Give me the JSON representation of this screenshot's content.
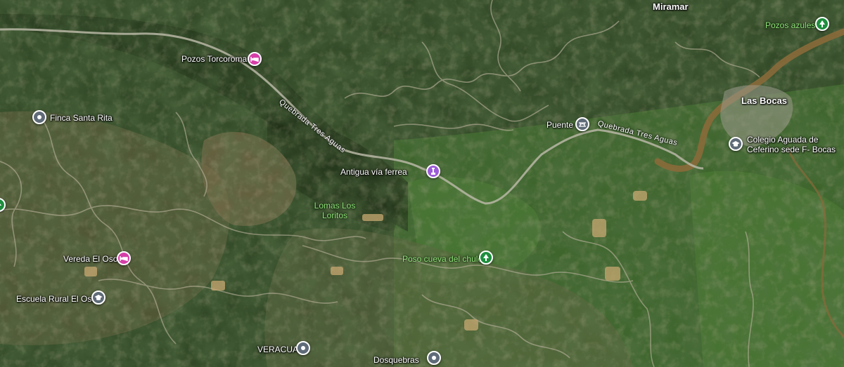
{
  "map": {
    "colors": {
      "poi_default": "#5f6b78",
      "poi_lodging": "#d63fa8",
      "poi_historic": "#9c5bd6",
      "poi_park": "#1e8e3e",
      "river": "#8a6a3a"
    },
    "towns": [
      {
        "id": "miramar",
        "name": "Miramar"
      },
      {
        "id": "las-bocas",
        "name": "Las Bocas"
      }
    ],
    "pois": [
      {
        "id": "pozos-torcoroma",
        "name": "Pozos Torcoroma",
        "icon": "bed-icon",
        "category": "lodging"
      },
      {
        "id": "finca-santa-rita",
        "name": "Finca Santa Rita",
        "icon": "generic-pin-icon",
        "category": "default"
      },
      {
        "id": "antigua-via-ferrea",
        "name": "Antigua vía ferrea",
        "icon": "monument-icon",
        "category": "historic"
      },
      {
        "id": "puente",
        "name": "Puente",
        "icon": "bridge-icon",
        "category": "default"
      },
      {
        "id": "colegio",
        "name": "Colegio Aguada de Ceferino sede F- Bocas",
        "icon": "school-icon",
        "category": "default"
      },
      {
        "id": "pozos-azules",
        "name": "Pozos azules",
        "icon": "tree-icon",
        "category": "park"
      },
      {
        "id": "vereda-el-oso",
        "name": "Vereda El Oso",
        "icon": "bed-icon",
        "category": "lodging"
      },
      {
        "id": "escuela-rural-el-oso",
        "name": "Escuela Rural El Oso",
        "icon": "school-icon",
        "category": "default"
      },
      {
        "id": "poso-cueva-del-chulo",
        "name": "Poso cueva del chulo",
        "icon": "tree-icon",
        "category": "park"
      },
      {
        "id": "veracua",
        "name": "VERACUA",
        "icon": "generic-pin-icon",
        "category": "default"
      },
      {
        "id": "dosquebras",
        "name": "Dosquebras",
        "icon": "generic-pin-icon",
        "category": "default"
      }
    ],
    "park_areas": [
      {
        "id": "lomas-los-loritos",
        "name": "Lomas Los Loritos"
      }
    ],
    "streams": [
      {
        "id": "quebrada-1",
        "name": "Quebrada Tres Aguas"
      },
      {
        "id": "quebrada-2",
        "name": "Quebrada Tres Aguas"
      }
    ]
  }
}
